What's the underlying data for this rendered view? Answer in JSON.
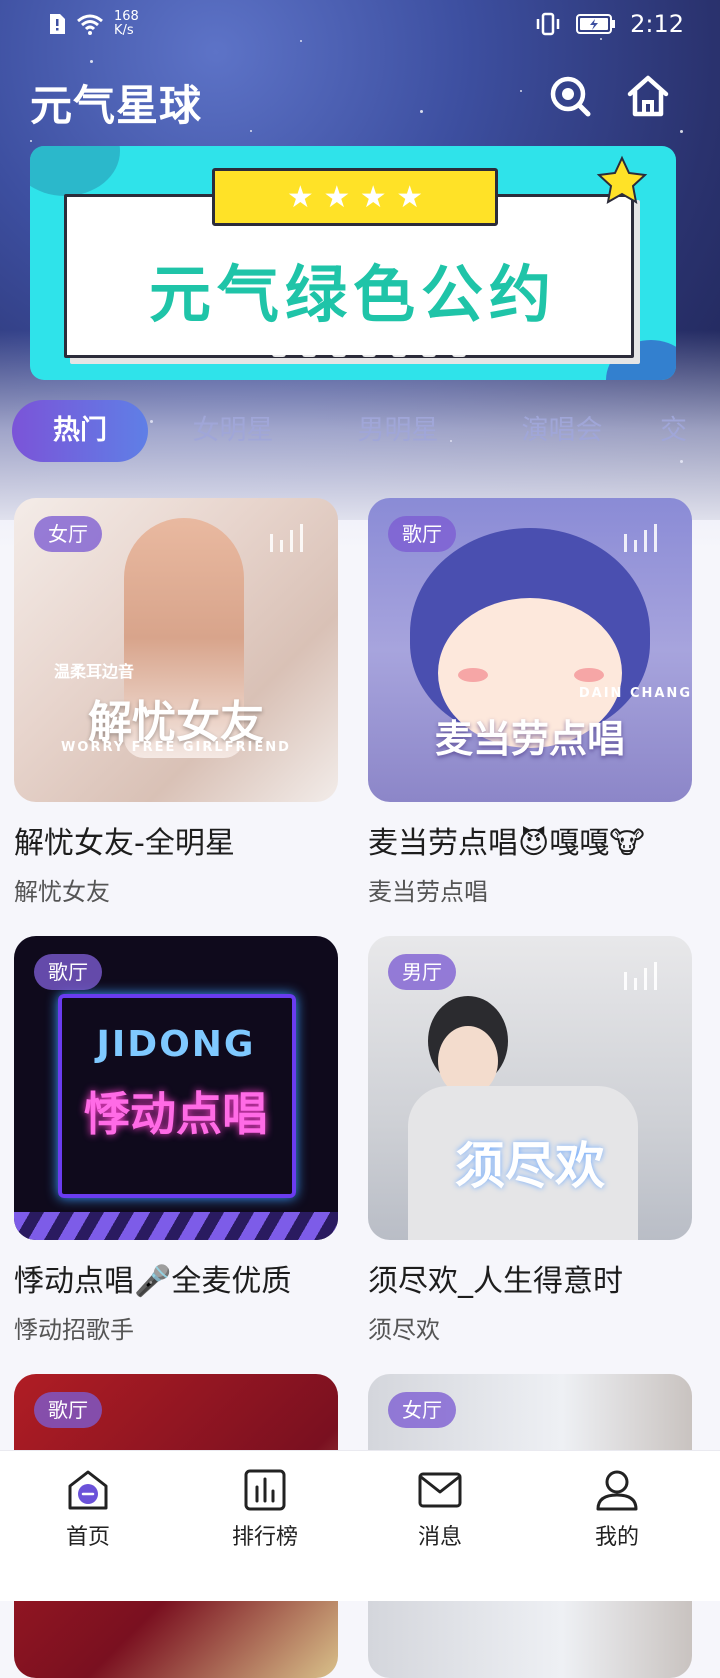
{
  "status_bar": {
    "speed": "168",
    "speed_unit": "K/s",
    "time": "2:12"
  },
  "header": {
    "title": "元气星球",
    "search_icon": "search-icon",
    "home_icon": "home-icon"
  },
  "banner": {
    "text": "元气绿色公约",
    "stars": "★ ★ ★ ★"
  },
  "tabs": [
    {
      "label": "热门",
      "active": true
    },
    {
      "label": "女明星"
    },
    {
      "label": "男明星"
    },
    {
      "label": "演唱会"
    },
    {
      "label": "交"
    }
  ],
  "rooms": [
    {
      "badge": "女厅",
      "title": "解忧女友-全明星",
      "subtitle": "解忧女友",
      "cover_text": "解忧女友",
      "cover_sub": "WORRY FREE GIRLFRIEND",
      "cover_top": "温柔耳边音"
    },
    {
      "badge": "歌厅",
      "title": "麦当劳点唱😈嘎嘎🐮",
      "subtitle": "麦当劳点唱",
      "cover_text": "麦当劳点唱",
      "cover_sub": "DAIN CHANG"
    },
    {
      "badge": "歌厅",
      "title": "悸动点唱🎤全麦优质",
      "subtitle": "悸动招歌手",
      "cover_text": "悸动点唱",
      "cover_sub": "JIDONG"
    },
    {
      "badge": "男厅",
      "title": "须尽欢_人生得意时",
      "subtitle": "须尽欢",
      "cover_text": "须尽欢"
    },
    {
      "badge": "歌厅"
    },
    {
      "badge": "女厅"
    }
  ],
  "bottom_nav": [
    {
      "label": "首页",
      "icon": "home-tab-icon",
      "active": true
    },
    {
      "label": "排行榜",
      "icon": "ranking-icon"
    },
    {
      "label": "消息",
      "icon": "message-icon"
    },
    {
      "label": "我的",
      "icon": "profile-icon"
    }
  ]
}
